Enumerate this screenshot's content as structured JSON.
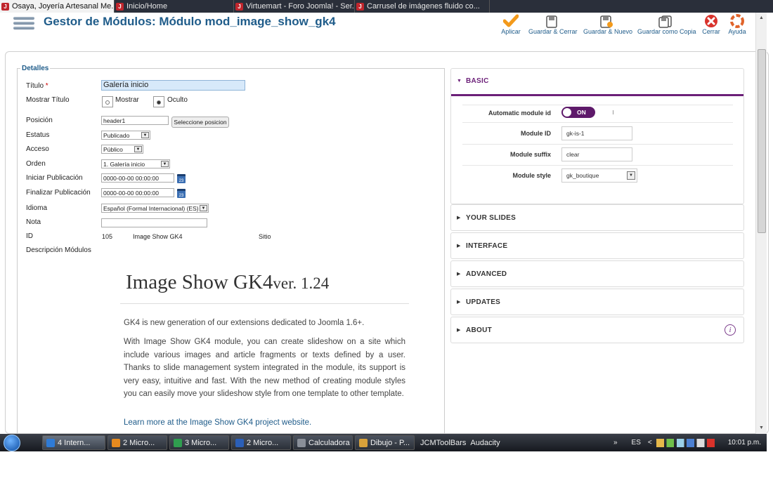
{
  "browser_tabs": [
    {
      "title": "Osaya, Joyería Artesanal Me...",
      "active": true
    },
    {
      "title": "Inicio/Home",
      "active": false
    },
    {
      "title": "Virtuemart - Foro Joomla! - Ser...",
      "active": false
    },
    {
      "title": "Carrusel de imágenes fluido co...",
      "active": false
    }
  ],
  "tab_close": "×",
  "header": {
    "title": "Gestor de Módulos: Módulo mod_image_show_gk4",
    "toolbar": {
      "apply": "Aplicar",
      "save_close": "Guardar & Cerrar",
      "save_new": "Guardar & Nuevo",
      "save_copy": "Guardar como Copia",
      "close": "Cerrar",
      "help": "Ayuda"
    }
  },
  "details": {
    "legend": "Detalles",
    "title_label": "Título",
    "required_mark": "*",
    "title_value": "Galería inicio",
    "show_title_label": "Mostrar Título",
    "show_option": "Mostrar",
    "hide_option": "Oculto",
    "position_label": "Posición",
    "position_value": "header1",
    "select_position_button": "Seleccione posicion",
    "status_label": "Estatus",
    "status_value": "Publicado",
    "access_label": "Acceso",
    "access_value": "Público",
    "order_label": "Orden",
    "order_value": "1. Galería inicio",
    "publish_up_label": "Iniciar Publicación",
    "publish_up_value": "0000-00-00 00:00:00",
    "publish_down_label": "Finalizar Publicación",
    "publish_down_value": "0000-00-00 00:00:00",
    "language_label": "Idioma",
    "language_value": "Español (Formal Internacional) (ES)",
    "note_label": "Nota",
    "note_value": "",
    "id_label": "ID",
    "id_value": "105",
    "module_type": "Image Show GK4",
    "client": "Sitio",
    "description_label": "Descripción Módulos",
    "calendar_day": "23"
  },
  "description": {
    "title": "Image Show GK4",
    "version": "ver. 1.24",
    "para1": "GK4 is new generation of our extensions dedicated to Joomla 1.6+.",
    "para2": "With Image Show GK4 module, you can create slideshow on a site which include various images and article fragments or texts defined by a user. Thanks to slide management system integrated in the module, its support is very easy, intuitive and fast. With the new method of creating module styles you can easily move your slideshow style from one template to other template.",
    "link": "Learn more at the Image Show GK4 project website."
  },
  "panels": {
    "basic": {
      "title": "BASIC",
      "auto_id_label": "Automatic module id",
      "auto_id_toggle": "ON",
      "module_id_label": "Module ID",
      "module_id_value": "gk-is-1",
      "module_suffix_label": "Module suffix",
      "module_suffix_value": "clear",
      "module_style_label": "Module style",
      "module_style_value": "gk_boutique"
    },
    "your_slides": "YOUR SLIDES",
    "interface": "INTERFACE",
    "advanced": "ADVANCED",
    "updates": "UPDATES",
    "about": "ABOUT"
  },
  "taskbar": {
    "items": [
      {
        "label": "4 Intern...",
        "active": true,
        "color": "#2f7bd6"
      },
      {
        "label": "2 Micro...",
        "active": false,
        "color": "#e58a1f"
      },
      {
        "label": "3 Micro...",
        "active": false,
        "color": "#2f9e4f"
      },
      {
        "label": "2 Micro...",
        "active": false,
        "color": "#2b5fb8"
      },
      {
        "label": "Calculadora",
        "active": false,
        "color": "#8a8f98"
      },
      {
        "label": "Dibujo - P...",
        "active": false,
        "color": "#d9a23a"
      }
    ],
    "extra1": "JCMToolBars",
    "extra2": "Audacity",
    "lang": "ES",
    "time": "10:01 p.m."
  },
  "colors": {
    "accent": "#1f5c8a",
    "basic_border": "#6b1f78",
    "toggle": "#5e1a6a"
  }
}
